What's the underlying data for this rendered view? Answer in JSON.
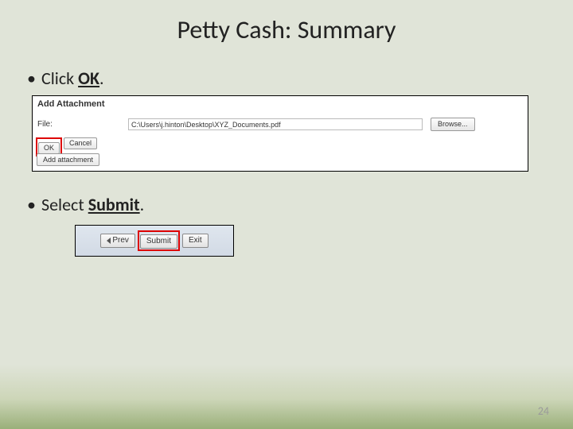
{
  "title": "Petty Cash: Summary",
  "bullet1_pre": "Click ",
  "bullet1_em": "OK",
  "bullet1_post": ".",
  "panel1": {
    "heading": "Add Attachment",
    "file_label": "File:",
    "file_value": "C:\\Users\\j.hinton\\Desktop\\XYZ_Documents.pdf",
    "browse": "Browse...",
    "ok": "OK",
    "cancel": "Cancel",
    "add_attachment": "Add attachment"
  },
  "bullet2_pre": "Select ",
  "bullet2_em": "Submit",
  "bullet2_post": ".",
  "panel2": {
    "prev": "Prev",
    "submit": "Submit",
    "exit": "Exit"
  },
  "page_number": "24"
}
